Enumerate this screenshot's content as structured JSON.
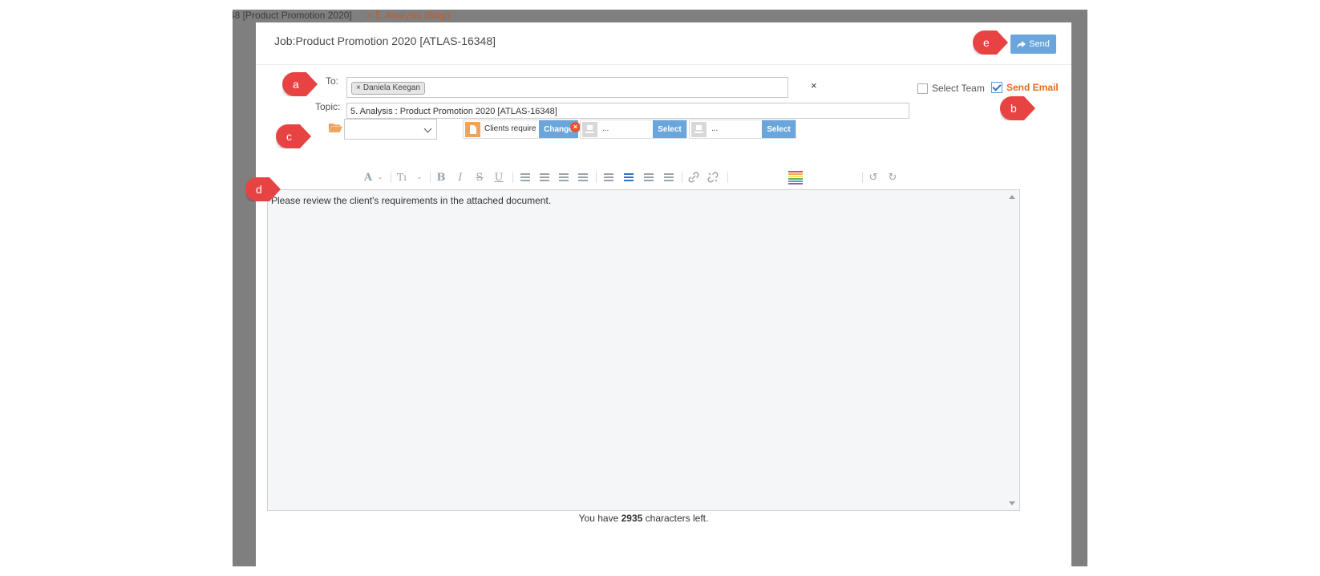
{
  "background": {
    "breadcrumb_left": "48 [Product Promotion 2020]",
    "breadcrumb_sep": ">",
    "breadcrumb_current": "5. Analysis (Blog)"
  },
  "header": {
    "job_title": "Job:Product Promotion 2020 [ATLAS-16348]",
    "send_label": "Send",
    "send_icon": "share-arrow-icon"
  },
  "recipients": {
    "to_label": "To:",
    "tags": [
      "Daniela Keegan"
    ],
    "tag_remove_glyph": "×",
    "clear_glyph": "×",
    "select_team_label": "Select Team",
    "select_team_checked": false,
    "send_email_label": "Send Email",
    "send_email_checked": true
  },
  "topic": {
    "label": "Topic:",
    "value": "5. Analysis : Product Promotion 2020 [ATLAS-16348]"
  },
  "attachments": {
    "folder_icon": "folder-open-icon",
    "folder_select_value": "",
    "file": {
      "name": "Clients require",
      "change_label": "Change",
      "remove_glyph": "×"
    },
    "slots": [
      {
        "text": "...",
        "button": "Select"
      },
      {
        "text": "...",
        "button": "Select"
      }
    ]
  },
  "toolbar": {
    "font_glyph": "A",
    "size_glyph": "Tı",
    "bold": "B",
    "italic": "I",
    "strike": "S",
    "underline": "U",
    "undo": "↺",
    "redo": "↻",
    "link": "🔗"
  },
  "editor": {
    "text": "Please review the client's requirements in the attached document."
  },
  "footer": {
    "prefix": "You have ",
    "count": "2935",
    "suffix": " characters left."
  },
  "callouts": [
    "a",
    "b",
    "c",
    "d",
    "e"
  ],
  "colors": {
    "accent": "#6aa6db",
    "send_email": "#e46b1e",
    "callout": "#e84343",
    "doc_icon": "#f0a35b",
    "remove": "#e8542f"
  }
}
